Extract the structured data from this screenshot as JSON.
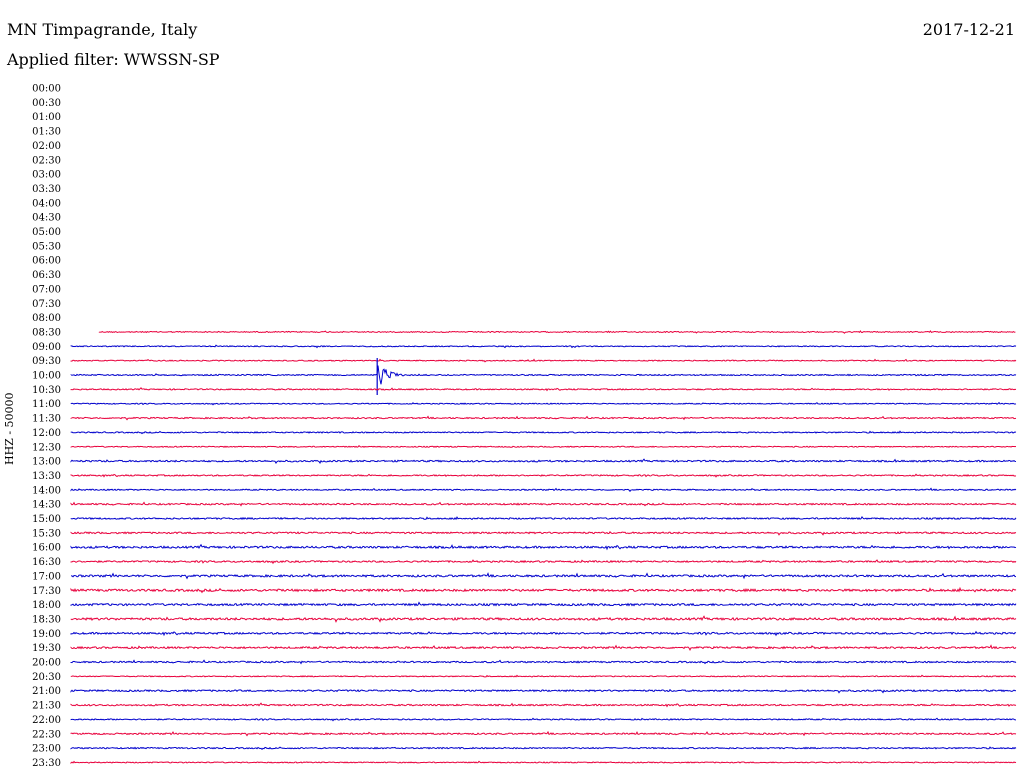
{
  "header": {
    "station": "MN Timpagrande, Italy",
    "date": "2017-12-21",
    "filter": "Applied filter: WWSSN-SP"
  },
  "chart_data": {
    "type": "line",
    "ylabel": "HHZ - 50000",
    "colors": {
      "even_line": "#0000cc",
      "odd_line": "#e8003c"
    },
    "rows": [
      {
        "time": "00:00",
        "data": false
      },
      {
        "time": "00:30",
        "data": false
      },
      {
        "time": "01:00",
        "data": false
      },
      {
        "time": "01:30",
        "data": false
      },
      {
        "time": "02:00",
        "data": false
      },
      {
        "time": "02:30",
        "data": false
      },
      {
        "time": "03:00",
        "data": false
      },
      {
        "time": "03:30",
        "data": false
      },
      {
        "time": "04:00",
        "data": false
      },
      {
        "time": "04:30",
        "data": false
      },
      {
        "time": "05:00",
        "data": false
      },
      {
        "time": "05:30",
        "data": false
      },
      {
        "time": "06:00",
        "data": false
      },
      {
        "time": "06:30",
        "data": false
      },
      {
        "time": "07:00",
        "data": false
      },
      {
        "time": "07:30",
        "data": false
      },
      {
        "time": "08:00",
        "data": false
      },
      {
        "time": "08:30",
        "data": true,
        "start_fraction": 0.03,
        "noise": 1.0
      },
      {
        "time": "09:00",
        "data": true,
        "noise": 1.0
      },
      {
        "time": "09:30",
        "data": true,
        "noise": 1.0
      },
      {
        "time": "10:00",
        "data": true,
        "noise": 1.2,
        "event_fraction": 0.324,
        "event_amplitude": 18
      },
      {
        "time": "10:30",
        "data": true,
        "noise": 1.2
      },
      {
        "time": "11:00",
        "data": true,
        "noise": 1.0
      },
      {
        "time": "11:30",
        "data": true,
        "noise": 1.3
      },
      {
        "time": "12:00",
        "data": true,
        "noise": 1.2
      },
      {
        "time": "12:30",
        "data": true,
        "noise": 1.0
      },
      {
        "time": "13:00",
        "data": true,
        "noise": 1.6
      },
      {
        "time": "13:30",
        "data": true,
        "noise": 1.3
      },
      {
        "time": "14:00",
        "data": true,
        "noise": 1.2
      },
      {
        "time": "14:30",
        "data": true,
        "noise": 1.5
      },
      {
        "time": "15:00",
        "data": true,
        "noise": 1.5
      },
      {
        "time": "15:30",
        "data": true,
        "noise": 1.6
      },
      {
        "time": "16:00",
        "data": true,
        "noise": 2.0
      },
      {
        "time": "16:30",
        "data": true,
        "noise": 1.6
      },
      {
        "time": "17:00",
        "data": true,
        "noise": 2.0
      },
      {
        "time": "17:30",
        "data": true,
        "noise": 2.2
      },
      {
        "time": "18:00",
        "data": true,
        "noise": 2.0
      },
      {
        "time": "18:30",
        "data": true,
        "noise": 2.2
      },
      {
        "time": "19:00",
        "data": true,
        "noise": 1.8
      },
      {
        "time": "19:30",
        "data": true,
        "noise": 1.8
      },
      {
        "time": "20:00",
        "data": true,
        "noise": 1.5
      },
      {
        "time": "20:30",
        "data": true,
        "noise": 1.0
      },
      {
        "time": "21:00",
        "data": true,
        "noise": 1.6
      },
      {
        "time": "21:30",
        "data": true,
        "noise": 1.5
      },
      {
        "time": "22:00",
        "data": true,
        "noise": 1.2
      },
      {
        "time": "22:30",
        "data": true,
        "noise": 1.5
      },
      {
        "time": "23:00",
        "data": true,
        "noise": 1.3
      },
      {
        "time": "23:30",
        "data": true,
        "noise": 1.0
      }
    ]
  }
}
